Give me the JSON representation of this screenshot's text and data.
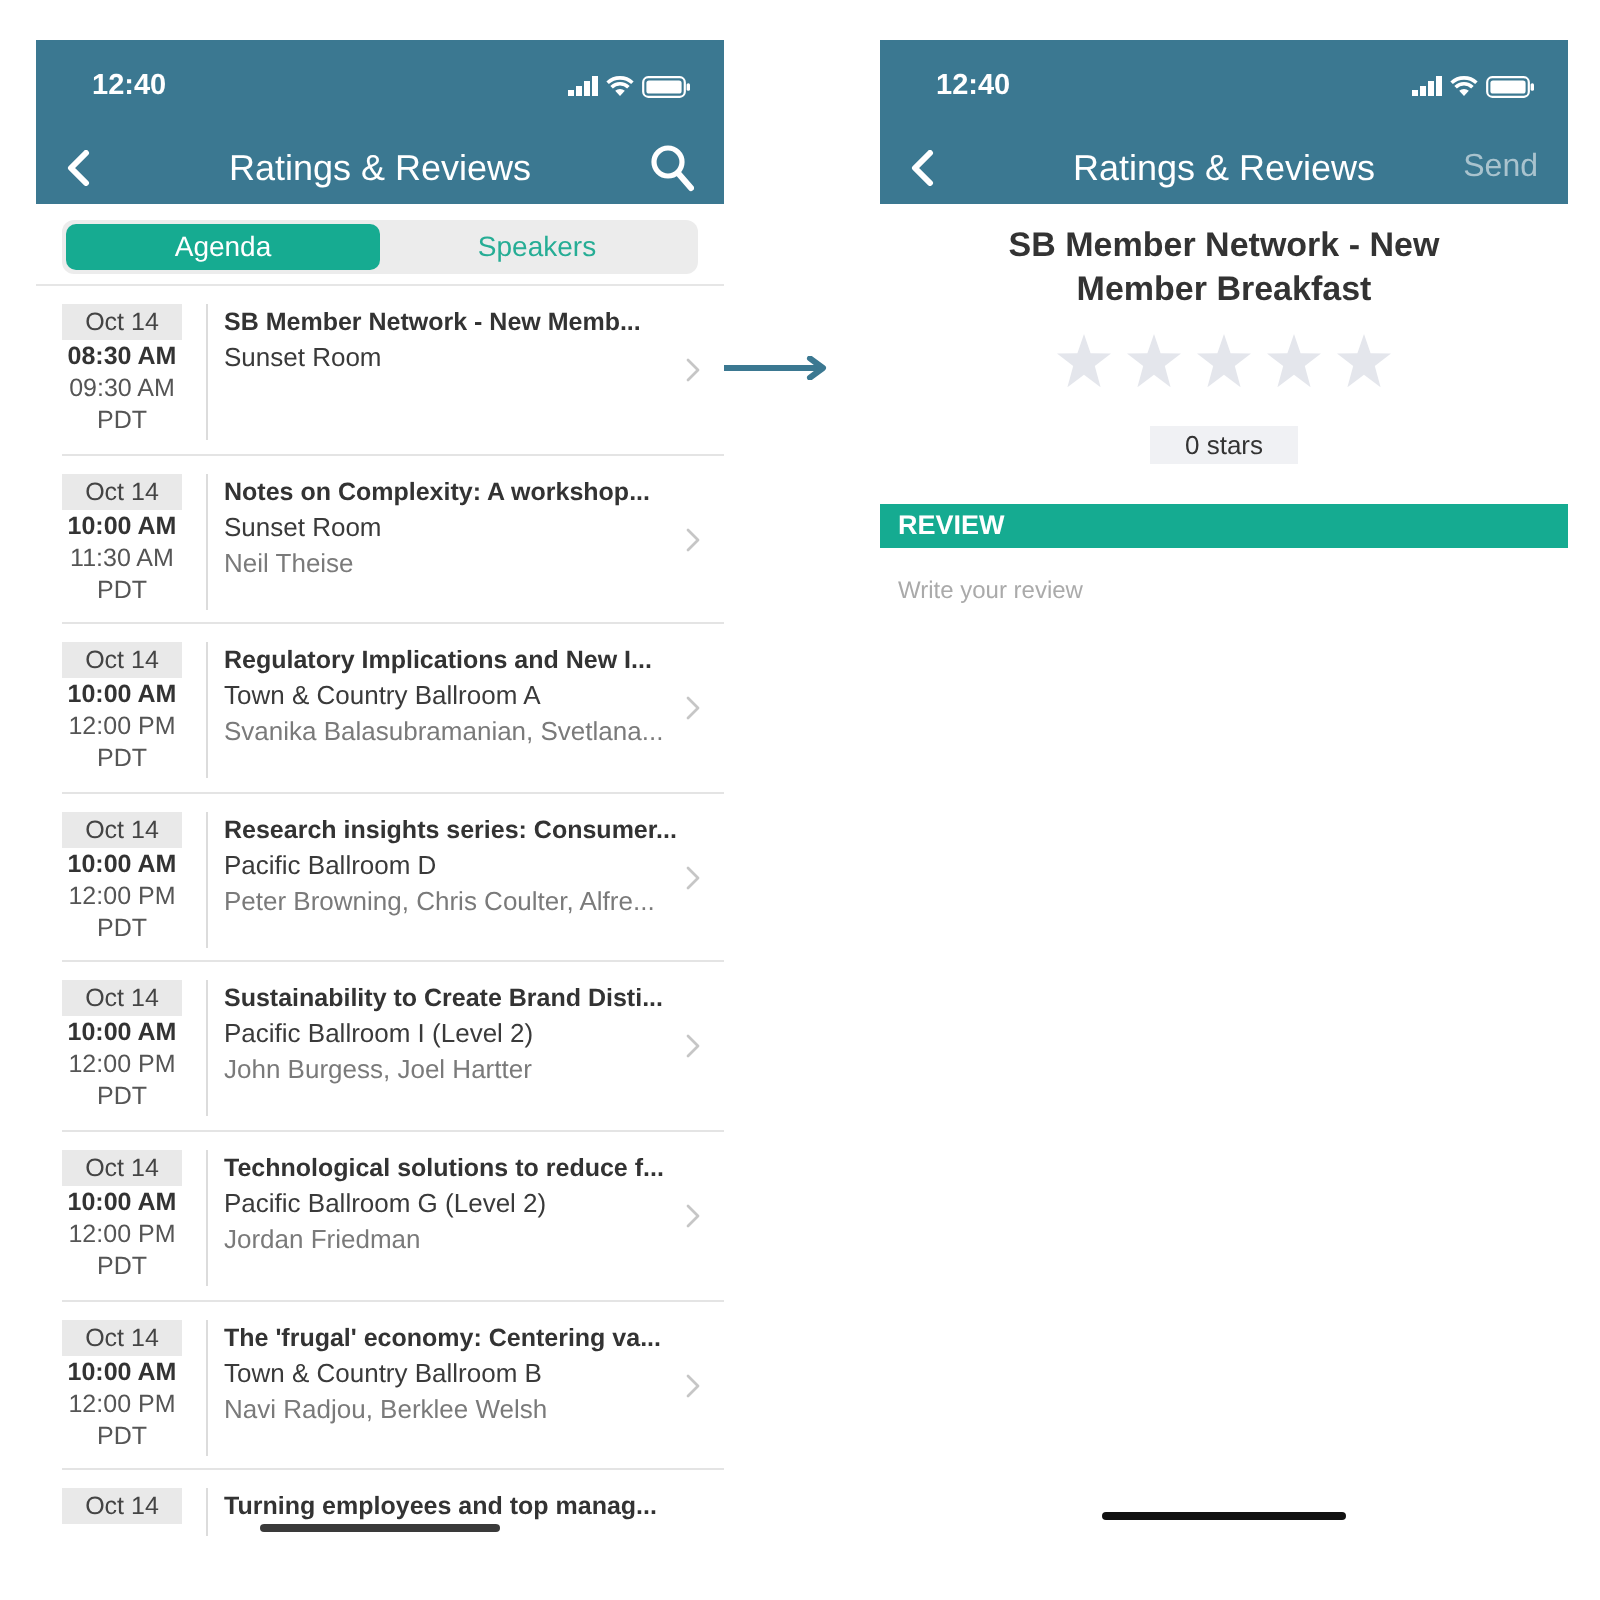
{
  "agenda_screen": {
    "status_bar": {
      "time": "12:40"
    },
    "nav_bar": {
      "title": "Ratings & Reviews"
    },
    "tabs": [
      {
        "label": "Agenda",
        "selected": true
      },
      {
        "label": "Speakers",
        "selected": false
      }
    ],
    "sessions": [
      {
        "date": "Oct 14",
        "start": "08:30 AM",
        "end": "09:30 AM",
        "timezone": "PDT",
        "title": "SB Member Network - New Memb...",
        "room": "Sunset Room"
      },
      {
        "date": "Oct 14",
        "start": "10:00 AM",
        "end": "11:30 AM",
        "timezone": "PDT",
        "title": "Notes on Complexity: A workshop...",
        "room": "Sunset Room",
        "speakers": "Neil Theise"
      },
      {
        "date": "Oct 14",
        "start": "10:00 AM",
        "end": "12:00 PM",
        "timezone": "PDT",
        "title": "Regulatory Implications and New I...",
        "room": "Town & Country Ballroom A",
        "speakers": "Svanika Balasubramanian, Svetlana..."
      },
      {
        "date": "Oct 14",
        "start": "10:00 AM",
        "end": "12:00 PM",
        "timezone": "PDT",
        "title": "Research insights series: Consumer...",
        "room": "Pacific Ballroom D",
        "speakers": "Peter Browning, Chris Coulter, Alfre..."
      },
      {
        "date": "Oct 14",
        "start": "10:00 AM",
        "end": "12:00 PM",
        "timezone": "PDT",
        "title": "Sustainability to Create Brand Disti...",
        "room": "Pacific Ballroom I (Level 2)",
        "speakers": "John Burgess, Joel Hartter"
      },
      {
        "date": "Oct 14",
        "start": "10:00 AM",
        "end": "12:00 PM",
        "timezone": "PDT",
        "title": "Technological solutions to reduce f...",
        "room": "Pacific Ballroom G (Level 2)",
        "speakers": "Jordan Friedman"
      },
      {
        "date": "Oct 14",
        "start": "10:00 AM",
        "end": "12:00 PM",
        "timezone": "PDT",
        "title": "The 'frugal' economy: Centering va...",
        "room": "Town & Country Ballroom B",
        "speakers": "Navi Radjou, Berklee Welsh"
      },
      {
        "date": "Oct 14",
        "title": "Turning employees and top manag..."
      }
    ]
  },
  "review_screen": {
    "status_bar": {
      "time": "12:40"
    },
    "nav_bar": {
      "title": "Ratings & Reviews",
      "action": {
        "label": "Send",
        "disabled": true
      }
    },
    "session_title": "SB Member Network - New Member Breakfast",
    "rating": {
      "stars": 0,
      "label": "0 stars"
    },
    "review_section": {
      "heading": "REVIEW",
      "placeholder": "Write your review"
    }
  }
}
